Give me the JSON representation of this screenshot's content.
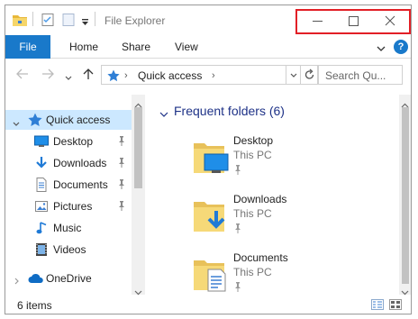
{
  "window": {
    "title": "File Explorer",
    "caption_highlight_color": "#e21f26"
  },
  "ribbon": {
    "file_label": "File",
    "tabs": [
      {
        "label": "Home"
      },
      {
        "label": "Share"
      },
      {
        "label": "View"
      }
    ],
    "help_label": "?",
    "accent_color": "#1979ca"
  },
  "address": {
    "path_label": "Quick access",
    "search_placeholder": "Search Qu..."
  },
  "nav": {
    "items": [
      {
        "label": "Quick access",
        "icon": "star-icon",
        "selected": true
      },
      {
        "label": "Desktop",
        "icon": "desktop-folder-icon",
        "pinned": true
      },
      {
        "label": "Downloads",
        "icon": "downloads-folder-icon",
        "pinned": true
      },
      {
        "label": "Documents",
        "icon": "documents-folder-icon",
        "pinned": true
      },
      {
        "label": "Pictures",
        "icon": "pictures-folder-icon",
        "pinned": true
      },
      {
        "label": "Music",
        "icon": "music-folder-icon",
        "pinned": false
      },
      {
        "label": "Videos",
        "icon": "videos-folder-icon",
        "pinned": false
      },
      {
        "label": "OneDrive",
        "icon": "onedrive-cloud-icon",
        "pinned": false
      }
    ]
  },
  "content": {
    "group_header": "Frequent folders (6)",
    "folders": [
      {
        "name": "Desktop",
        "location": "This PC",
        "icon": "desktop-folder-icon"
      },
      {
        "name": "Downloads",
        "location": "This PC",
        "icon": "downloads-folder-icon"
      },
      {
        "name": "Documents",
        "location": "This PC",
        "icon": "documents-folder-icon"
      }
    ]
  },
  "status": {
    "item_count": "6 items"
  }
}
